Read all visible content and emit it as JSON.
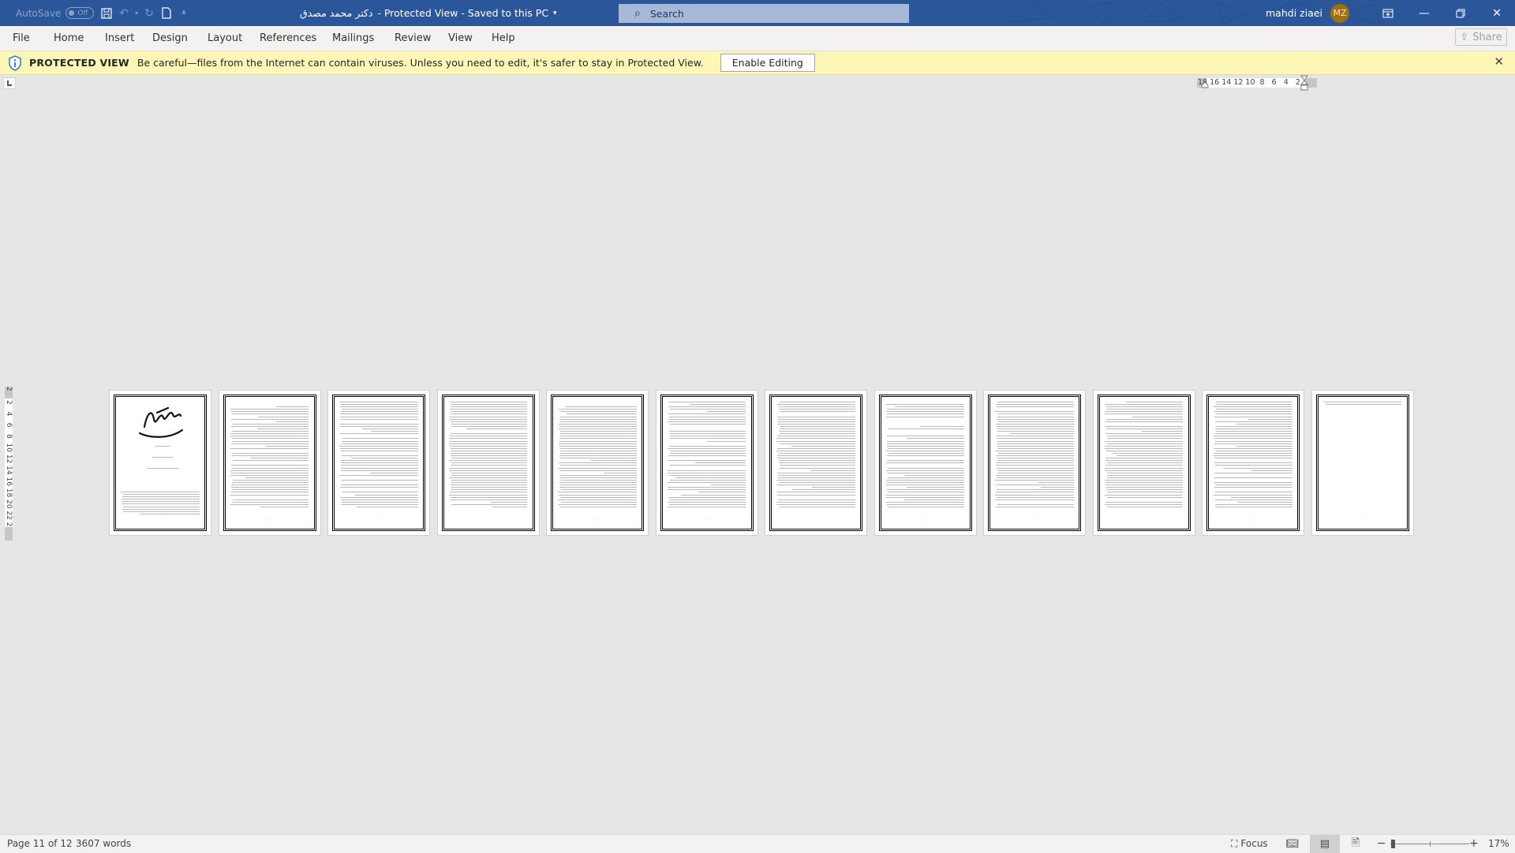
{
  "titlebar": {
    "autosave_label": "AutoSave",
    "autosave_state": "Off",
    "doc_name": "دکتر محمد مصدق",
    "doc_status": " -  Protected View  -  Saved to this PC",
    "search_placeholder": "Search",
    "user_name": "mahdi ziaei",
    "user_initials": "MZ",
    "quick_access": [
      "save-icon",
      "undo-icon",
      "redo-icon",
      "new-document-icon",
      "customize-quick-access-icon"
    ],
    "window_controls": [
      "ribbon-display-options-icon",
      "minimize-icon",
      "restore-icon",
      "close-icon"
    ]
  },
  "ribbon": {
    "tabs": [
      "File",
      "Home",
      "Insert",
      "Design",
      "Layout",
      "References",
      "Mailings",
      "Review",
      "View",
      "Help"
    ],
    "share_label": "Share"
  },
  "message_bar": {
    "title": "PROTECTED VIEW",
    "message": "Be careful—files from the Internet can contain viruses. Unless you need to edit, it's safer to stay in Protected View.",
    "button_label": "Enable Editing"
  },
  "rulers": {
    "horizontal": "18 16 14 12 10  8   6   4   2",
    "vertical": "2    2   4   6   8  10 12 14 16 18 20 22 24"
  },
  "document": {
    "page_count": 12,
    "pages": [
      {
        "n": 1,
        "type": "cover"
      },
      {
        "n": 2,
        "type": "text"
      },
      {
        "n": 3,
        "type": "text"
      },
      {
        "n": 4,
        "type": "text"
      },
      {
        "n": 5,
        "type": "text"
      },
      {
        "n": 6,
        "type": "text"
      },
      {
        "n": 7,
        "type": "text"
      },
      {
        "n": 8,
        "type": "text"
      },
      {
        "n": 9,
        "type": "text"
      },
      {
        "n": 10,
        "type": "text"
      },
      {
        "n": 11,
        "type": "text"
      },
      {
        "n": 12,
        "type": "short"
      }
    ]
  },
  "status_bar": {
    "page_info": "Page 11 of 12",
    "word_count": "3607 words",
    "focus_label": "Focus",
    "views": [
      "read-mode",
      "print-layout",
      "web-layout"
    ],
    "active_view": "print-layout",
    "zoom_out": "−",
    "zoom_in": "+",
    "zoom_level": "17%"
  }
}
